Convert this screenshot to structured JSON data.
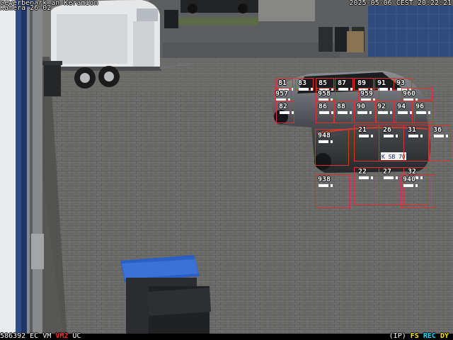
{
  "osd": {
    "title": "Gewerbepark an Keramion",
    "camera": "Kamera 26-02",
    "datetime": "2025-05-06 CEST 20:22:21",
    "bottom_left": {
      "frame": "586392",
      "ec": "EC",
      "vm": "VM",
      "vm2": "VM2",
      "uc": "UC"
    },
    "bottom_right": {
      "ip": "(IP)",
      "fs": "FS",
      "rec": "REC",
      "dy": "DY"
    }
  },
  "colors": {
    "vm2": "#ff2b2b",
    "fs": "#ffe500",
    "rec": "#00e0ff",
    "dy": "#ffe500",
    "box": "#e0302b"
  },
  "plate": "K SB 707",
  "detections": [
    {
      "label": "81"
    },
    {
      "label": "83"
    },
    {
      "label": "85"
    },
    {
      "label": "87"
    },
    {
      "label": "89"
    },
    {
      "label": "91"
    },
    {
      "label": "93"
    },
    {
      "label": "957"
    },
    {
      "label": "958"
    },
    {
      "label": "959"
    },
    {
      "label": "960"
    },
    {
      "label": "82"
    },
    {
      "label": "86"
    },
    {
      "label": "88"
    },
    {
      "label": "90"
    },
    {
      "label": "92"
    },
    {
      "label": "94"
    },
    {
      "label": "96"
    },
    {
      "label": "948"
    },
    {
      "label": "21"
    },
    {
      "label": "26"
    },
    {
      "label": "31"
    },
    {
      "label": "36"
    },
    {
      "label": "938"
    },
    {
      "label": "22"
    },
    {
      "label": "27"
    },
    {
      "label": "32"
    },
    {
      "label": "940"
    }
  ]
}
